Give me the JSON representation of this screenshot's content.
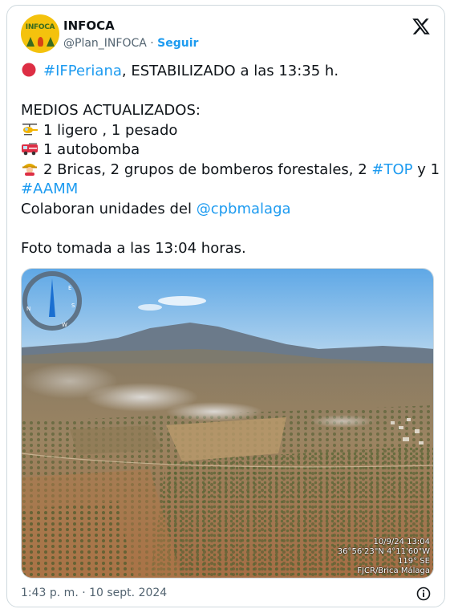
{
  "account": {
    "name": "INFOCA",
    "handle": "@Plan_INFOCA",
    "separator": "·",
    "follow_label": "Seguir",
    "avatar_text": "INFOCA"
  },
  "tweet": {
    "line1_hashtag": "#IFPeriana",
    "line1_rest": ", ESTABILIZADO a las 13:35 h.",
    "medios_heading": "MEDIOS ACTUALIZADOS:",
    "aircraft": "1 ligero , 1 pesado",
    "engine": "1 autobomba",
    "crews_text": "2 Bricas, 2 grupos de bomberos forestales, 2 ",
    "crews_hashtag": "#TOP",
    "crews_tail": " y 1",
    "aamm_hashtag": "#AAMM",
    "collab_text": "Colaboran unidades del ",
    "collab_mention": "@cpbmalaga",
    "photo_note": "Foto tomada a las 13:04 horas."
  },
  "photo": {
    "stamp_date": "10/9/24 13:04",
    "stamp_coords": "36°56'23\"N 4°11'60\"W",
    "stamp_heading": "119° SE",
    "stamp_credit": "FJCR/Brica Málaga",
    "compass_letters": [
      "N",
      "E",
      "S",
      "W"
    ]
  },
  "footer": {
    "timestamp": "1:43 p. m. · 10 sept. 2024"
  },
  "colors": {
    "link": "#1d9bf0",
    "text": "#0f1419",
    "muted": "#536471",
    "status_dot": "#e0245e"
  },
  "icons": [
    "x-logo-icon",
    "red-circle-icon",
    "helicopter-icon",
    "fire-engine-icon",
    "firefighter-icon",
    "info-icon",
    "compass-icon"
  ]
}
